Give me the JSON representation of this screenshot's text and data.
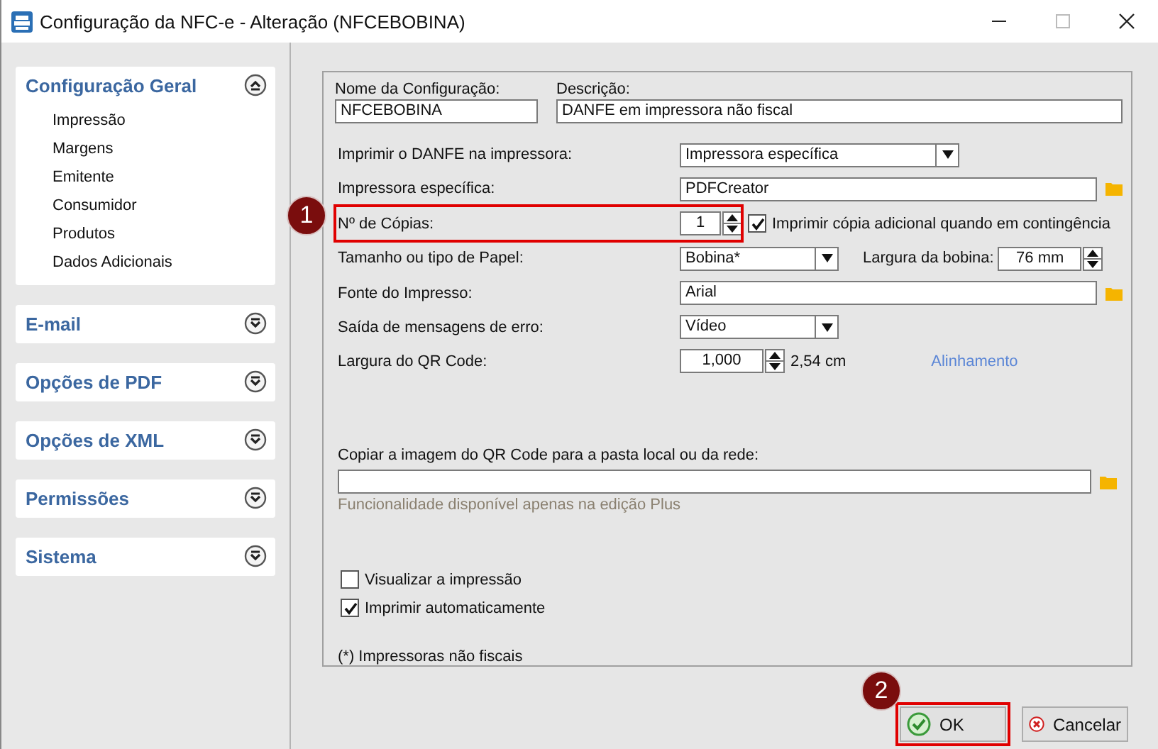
{
  "window": {
    "title": "Configuração da NFC-e - Alteração  (NFCEBOBINA)"
  },
  "sidebar": {
    "sections": [
      {
        "title": "Configuração Geral",
        "expanded": true,
        "items": [
          "Impressão",
          "Margens",
          "Emitente",
          "Consumidor",
          "Produtos",
          "Dados Adicionais"
        ]
      },
      {
        "title": "E-mail",
        "expanded": false
      },
      {
        "title": "Opções de PDF",
        "expanded": false
      },
      {
        "title": "Opções de XML",
        "expanded": false
      },
      {
        "title": "Permissões",
        "expanded": false
      },
      {
        "title": "Sistema",
        "expanded": false
      }
    ]
  },
  "form": {
    "name": {
      "label": "Nome da Configuração:",
      "value": "NFCEBOBINA"
    },
    "description": {
      "label": "Descrição:",
      "value": "DANFE em impressora não fiscal"
    },
    "rows": [
      {
        "kind": "wideselect",
        "label": "Imprimir o DANFE na impressora:",
        "value": "Impressora específica"
      },
      {
        "kind": "folderfield",
        "label": "Impressora específica:",
        "value": "PDFCreator"
      },
      {
        "kind": "spincheck",
        "label": "Nº de Cópias:",
        "value": "1",
        "check_label": "Imprimir cópia adicional quando em contingência",
        "checked": true,
        "highlighted": true,
        "badge": "1"
      },
      {
        "kind": "selectspin",
        "label": "Tamanho ou tipo de Papel:",
        "value": "Bobina*",
        "extra_label": "Largura da bobina:",
        "extra_value": "76 mm"
      },
      {
        "kind": "folderfield",
        "label": "Fonte do Impresso:",
        "value": "Arial"
      },
      {
        "kind": "select",
        "label": "Saída de mensagens de erro:",
        "value": "Vídeo"
      },
      {
        "kind": "spinlink",
        "label": "Largura do QR Code:",
        "value": "1,000",
        "unit": "2,54 cm",
        "link": "Alinhamento"
      }
    ],
    "copy": {
      "label": "Copiar a imagem do QR Code para a pasta local ou da rede:",
      "hint": "Funcionalidade disponível apenas na edição Plus"
    },
    "checks": [
      {
        "label": "Visualizar a impressão",
        "checked": false
      },
      {
        "label": "Imprimir automaticamente",
        "checked": true
      }
    ],
    "note": "(*) Impressoras não fiscais"
  },
  "buttons": [
    {
      "kind": "ok",
      "label": "OK",
      "highlighted": true,
      "badge": "2"
    },
    {
      "kind": "cancel",
      "label": "Cancelar",
      "highlighted": false
    }
  ]
}
